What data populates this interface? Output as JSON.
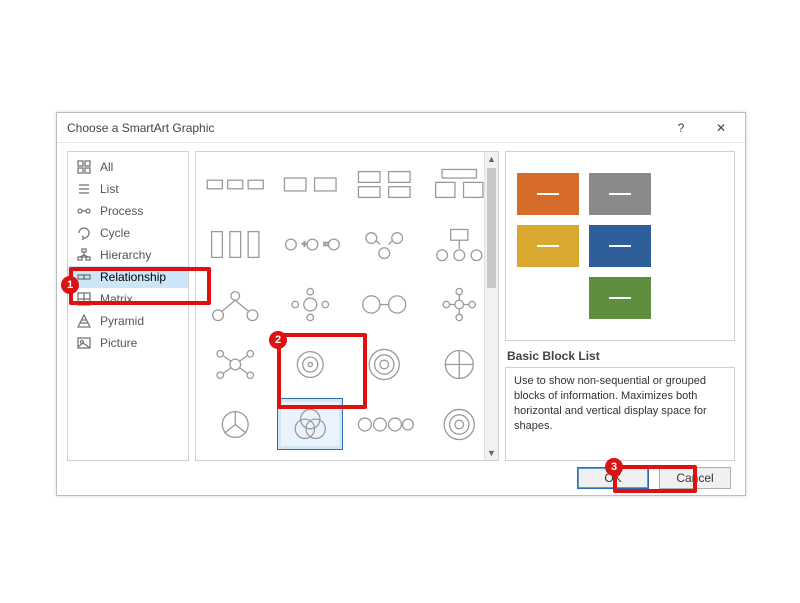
{
  "dialog": {
    "title": "Choose a SmartArt Graphic",
    "help_label": "?",
    "close_label": "✕"
  },
  "sidebar": {
    "items": [
      {
        "label": "All"
      },
      {
        "label": "List"
      },
      {
        "label": "Process"
      },
      {
        "label": "Cycle"
      },
      {
        "label": "Hierarchy"
      },
      {
        "label": "Relationship",
        "selected": true
      },
      {
        "label": "Matrix"
      },
      {
        "label": "Pyramid"
      },
      {
        "label": "Picture"
      }
    ]
  },
  "gallery": {
    "selected_index": 17
  },
  "preview": {
    "name": "Basic Block List",
    "description": "Use to show non-sequential or grouped blocks of information. Maximizes both horizontal and vertical display space for shapes.",
    "blocks": [
      {
        "color": "#d76b2a"
      },
      {
        "color": "#8a8a8a"
      },
      {
        "color": "#d9a92f"
      },
      {
        "color": "#2f5f9b"
      },
      {
        "color": "#5f8e3e"
      }
    ]
  },
  "buttons": {
    "ok": "OK",
    "cancel": "Cancel"
  },
  "callouts": {
    "c1": "1",
    "c2": "2",
    "c3": "3"
  }
}
